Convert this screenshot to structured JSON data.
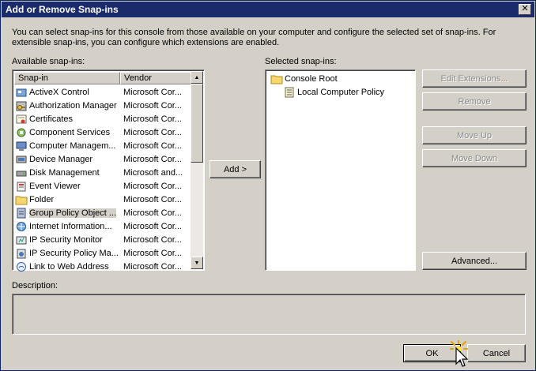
{
  "window": {
    "title": "Add or Remove Snap-ins",
    "close_glyph": "✕"
  },
  "intro_text": "You can select snap-ins for this console from those available on your computer and configure the selected set of snap-ins. For extensible snap-ins, you can configure which extensions are enabled.",
  "available": {
    "label": "Available snap-ins:",
    "columns": [
      "Snap-in",
      "Vendor"
    ],
    "rows": [
      {
        "name": "ActiveX Control",
        "vendor": "Microsoft Cor...",
        "icon": "activex-icon"
      },
      {
        "name": "Authorization Manager",
        "vendor": "Microsoft Cor...",
        "icon": "authorization-icon"
      },
      {
        "name": "Certificates",
        "vendor": "Microsoft Cor...",
        "icon": "certificate-icon"
      },
      {
        "name": "Component Services",
        "vendor": "Microsoft Cor...",
        "icon": "component-icon"
      },
      {
        "name": "Computer Managem...",
        "vendor": "Microsoft Cor...",
        "icon": "computer-icon"
      },
      {
        "name": "Device Manager",
        "vendor": "Microsoft Cor...",
        "icon": "device-icon"
      },
      {
        "name": "Disk Management",
        "vendor": "Microsoft and...",
        "icon": "disk-icon"
      },
      {
        "name": "Event Viewer",
        "vendor": "Microsoft Cor...",
        "icon": "event-icon"
      },
      {
        "name": "Folder",
        "vendor": "Microsoft Cor...",
        "icon": "folder-icon"
      },
      {
        "name": "Group Policy Object ...",
        "vendor": "Microsoft Cor...",
        "icon": "policy-icon"
      },
      {
        "name": "Internet Information...",
        "vendor": "Microsoft Cor...",
        "icon": "iis-icon"
      },
      {
        "name": "IP Security Monitor",
        "vendor": "Microsoft Cor...",
        "icon": "ipsec-icon"
      },
      {
        "name": "IP Security Policy Ma...",
        "vendor": "Microsoft Cor...",
        "icon": "ipsec-policy-icon"
      },
      {
        "name": "Link to Web Address",
        "vendor": "Microsoft Cor...",
        "icon": "link-icon"
      }
    ],
    "scroll_up": "▲",
    "scroll_down": "▼"
  },
  "add_button": "Add >",
  "selected": {
    "label": "Selected snap-ins:",
    "root": "Console Root",
    "child": "Local Computer Policy"
  },
  "buttons": {
    "edit_extensions": "Edit Extensions...",
    "remove": "Remove",
    "move_up": "Move Up",
    "move_down": "Move Down",
    "advanced": "Advanced...",
    "ok": "OK",
    "cancel": "Cancel"
  },
  "description_label": "Description:",
  "colors": {
    "titlebar": "#1a2b6b",
    "dialog": "#d4d0c8"
  }
}
